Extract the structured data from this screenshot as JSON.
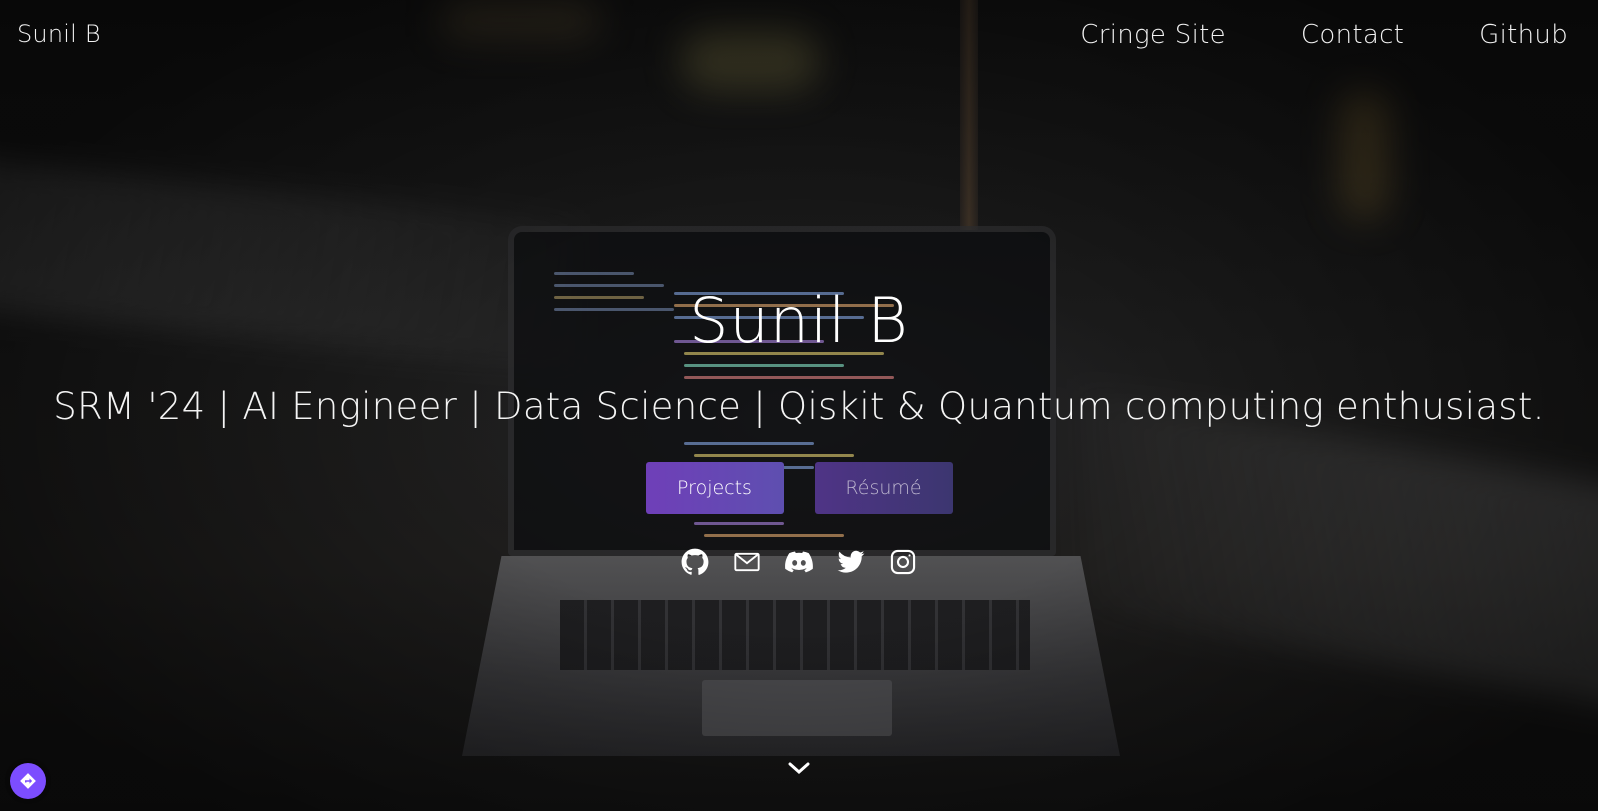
{
  "header": {
    "brand": "Sunil B",
    "nav": [
      {
        "label": "Cringe Site"
      },
      {
        "label": "Contact"
      },
      {
        "label": "Github"
      }
    ]
  },
  "hero": {
    "title": "Sunil B",
    "subtitle": "SRM '24 | AI Engineer | Data Science | Qiskit & Quantum computing enthusiast.",
    "buttons": {
      "projects": "Projects",
      "resume": "Résumé"
    },
    "social_icons": [
      "github-icon",
      "mail-icon",
      "discord-icon",
      "twitter-icon",
      "instagram-icon"
    ]
  },
  "scroll_icon": "chevron-down-icon",
  "floating_button_icon": "directions-icon",
  "colors": {
    "accent": "#6f3fb8",
    "resume_button": "#4f3486",
    "floating_button": "#7c4dff",
    "text": "#ffffff"
  }
}
